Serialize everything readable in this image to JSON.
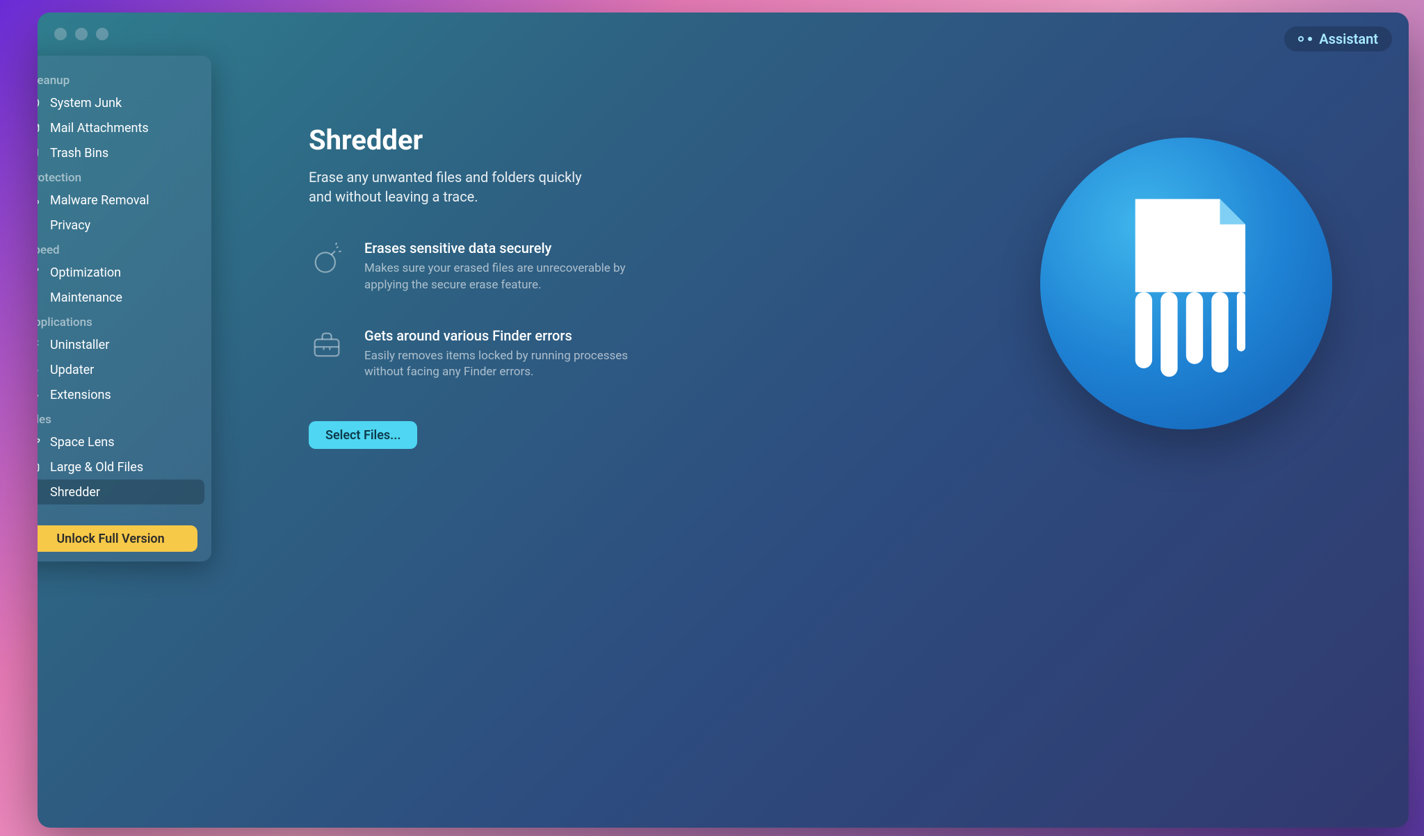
{
  "assistant_label": "Assistant",
  "sidebar": {
    "sections": [
      {
        "label": "Cleanup",
        "items": [
          {
            "id": "system-junk",
            "label": "System Junk",
            "icon": "disk-icon"
          },
          {
            "id": "mail-attachments",
            "label": "Mail Attachments",
            "icon": "mail-icon"
          },
          {
            "id": "trash-bins",
            "label": "Trash Bins",
            "icon": "trash-icon"
          }
        ]
      },
      {
        "label": "Protection",
        "items": [
          {
            "id": "malware-removal",
            "label": "Malware Removal",
            "icon": "biohazard-icon"
          },
          {
            "id": "privacy",
            "label": "Privacy",
            "icon": "hand-icon"
          }
        ]
      },
      {
        "label": "Speed",
        "items": [
          {
            "id": "optimization",
            "label": "Optimization",
            "icon": "sliders-icon"
          },
          {
            "id": "maintenance",
            "label": "Maintenance",
            "icon": "wrench-icon"
          }
        ]
      },
      {
        "label": "Applications",
        "items": [
          {
            "id": "uninstaller",
            "label": "Uninstaller",
            "icon": "uninstall-icon"
          },
          {
            "id": "updater",
            "label": "Updater",
            "icon": "update-icon"
          },
          {
            "id": "extensions",
            "label": "Extensions",
            "icon": "puzzle-icon"
          }
        ]
      },
      {
        "label": "Files",
        "items": [
          {
            "id": "space-lens",
            "label": "Space Lens",
            "icon": "planet-icon"
          },
          {
            "id": "large-old-files",
            "label": "Large & Old Files",
            "icon": "folder-icon"
          },
          {
            "id": "shredder",
            "label": "Shredder",
            "icon": "shredder-icon",
            "active": true
          }
        ]
      }
    ],
    "unlock_label": "Unlock Full Version"
  },
  "main": {
    "title": "Shredder",
    "subtitle": "Erase any unwanted files and folders quickly and without leaving a trace.",
    "features": [
      {
        "id": "secure-erase",
        "icon": "bomb-icon",
        "title": "Erases sensitive data securely",
        "desc": "Makes sure your erased files are unrecoverable by applying the secure erase feature."
      },
      {
        "id": "finder-errors",
        "icon": "toolbox-icon",
        "title": "Gets around various Finder errors",
        "desc": "Easily removes items locked by running processes without facing any Finder errors."
      }
    ],
    "select_button": "Select Files..."
  }
}
